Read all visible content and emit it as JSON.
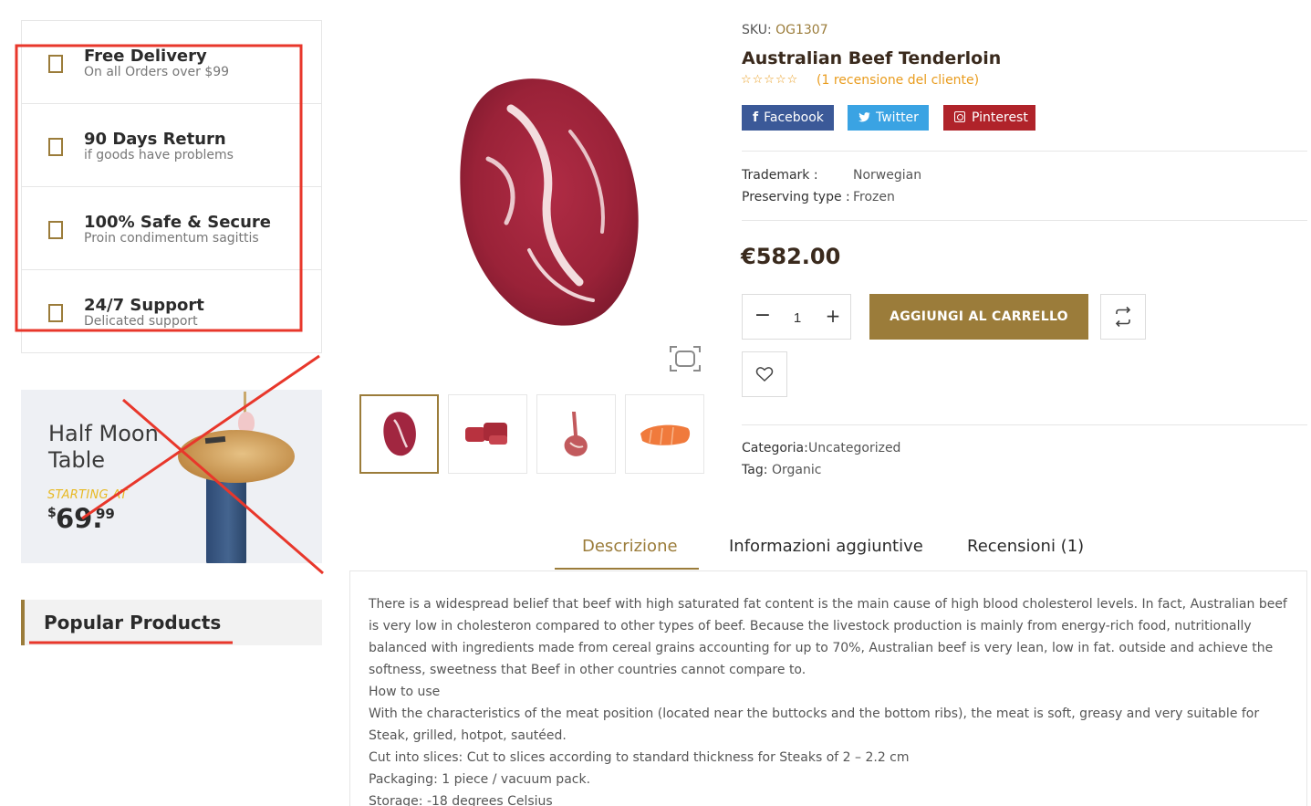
{
  "colors": {
    "accent": "#9b7c3a",
    "star": "#e99c1e",
    "facebook": "#3b5998",
    "twitter": "#3aa3e3",
    "pinterest": "#b0232a",
    "annotation": "#e8372b"
  },
  "sidebar": {
    "features": [
      {
        "title": "Free Delivery",
        "subtitle": "On all Orders over $99",
        "icon": "box-icon"
      },
      {
        "title": "90 Days Return",
        "subtitle": "if goods have problems",
        "icon": "box-icon"
      },
      {
        "title": "100% Safe & Secure",
        "subtitle": "Proin condimentum sagittis",
        "icon": "box-icon"
      },
      {
        "title": "24/7 Support",
        "subtitle": "Delicated support",
        "icon": "box-icon"
      }
    ],
    "banner": {
      "title": "Half Moon Table",
      "starting": "STARTING AT",
      "currency": "$",
      "price_int": "69.",
      "price_dec": "99"
    },
    "popular_title": "Popular Products"
  },
  "product": {
    "sku_label": "SKU:",
    "sku": "OG1307",
    "title": "Australian Beef Tenderloin",
    "stars": "☆☆☆☆☆",
    "reviews_link": "(1 recensione del cliente)",
    "share": {
      "facebook": "Facebook",
      "twitter": "Twitter",
      "pinterest": "Pinterest"
    },
    "attributes": [
      {
        "label": "Trademark :",
        "value": "Norwegian"
      },
      {
        "label": "Preserving type :",
        "value": "Frozen"
      }
    ],
    "price": "€582.00",
    "quantity": "1",
    "minus": "−",
    "plus": "+",
    "add_to_cart": "AGGIUNGI AL CARRELLO",
    "category_label": "Categoria:",
    "category": "Uncategorized",
    "tag_label": "Tag:",
    "tag": "Organic"
  },
  "tabs": [
    {
      "label": "Descrizione",
      "active": true
    },
    {
      "label": "Informazioni aggiuntive",
      "active": false
    },
    {
      "label": "Recensioni (1)",
      "active": false
    }
  ],
  "description": [
    "There is a widespread belief that beef with high saturated fat content is the main cause of high blood cholesterol levels. In fact, Australian beef is very low in cholesteron compared to other types of beef. Because the livestock production is mainly from energy-rich food, nutritionally balanced with ingredients made from cereal grains accounting for up to 70%, Australian beef is very lean, low in fat. outside and achieve the softness, sweetness that Beef in other countries cannot compare to.",
    "How to use",
    "With the characteristics of the meat position (located near the buttocks and the bottom ribs), the meat is soft, greasy and very suitable for Steak, grilled, hotpot, sautéed.",
    "Cut into slices: Cut to slices according to standard thickness for Steaks of 2 – 2.2 cm",
    "Packaging: 1 piece / vacuum pack.",
    "Storage: -18 degrees Celsius"
  ]
}
